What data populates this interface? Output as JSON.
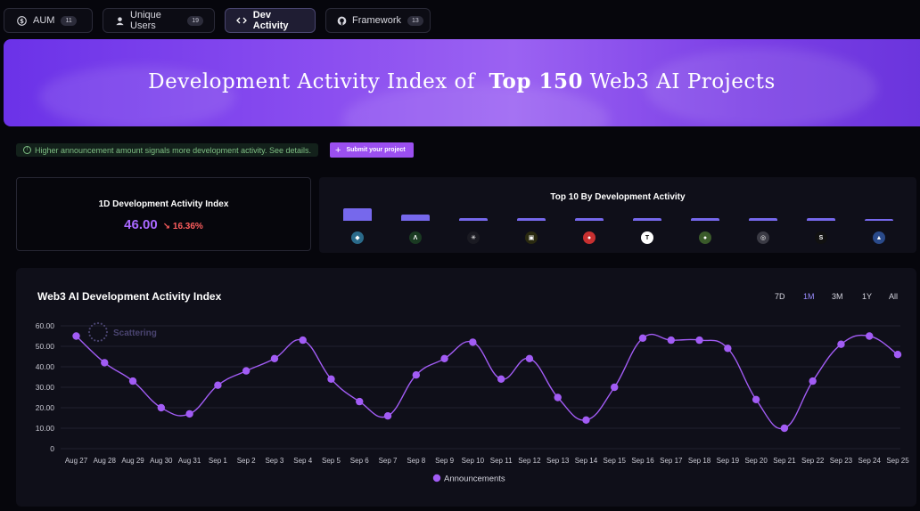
{
  "tabs": [
    {
      "label": "AUM",
      "badge": "11",
      "icon": "dollar-icon"
    },
    {
      "label": "Unique Users",
      "badge": "19",
      "icon": "user-icon"
    },
    {
      "label": "Dev Activity",
      "badge": "",
      "icon": "code-icon"
    },
    {
      "label": "Framework",
      "badge": "13",
      "icon": "github-icon"
    }
  ],
  "banner": {
    "prefix": "Development Activity Index of",
    "highlight": "Top 150",
    "suffix": "Web3 AI Projects"
  },
  "notice": {
    "text": "Higher announcement amount signals more development activity. See details."
  },
  "submit": {
    "label": "Submit your project"
  },
  "index_card": {
    "title": "1D Development Activity Index",
    "value": "46.00",
    "change": "16.36%",
    "change_arrow": "↘"
  },
  "top10": {
    "title": "Top 10 By Development Activity",
    "values": [
      100,
      48,
      24,
      24,
      22,
      22,
      22,
      22,
      22,
      10
    ],
    "icons": [
      {
        "name": "project-1-icon",
        "color": "#2a6a8a",
        "glyph": "◆"
      },
      {
        "name": "project-2-icon",
        "color": "#1a3a22",
        "glyph": "Λ"
      },
      {
        "name": "project-3-icon",
        "color": "#1a1a22",
        "glyph": "✳"
      },
      {
        "name": "project-4-icon",
        "color": "#2a2a10",
        "glyph": "▣"
      },
      {
        "name": "project-5-icon",
        "color": "#c83030",
        "glyph": "●"
      },
      {
        "name": "project-6-icon",
        "color": "#ffffff",
        "glyph": "T"
      },
      {
        "name": "project-7-icon",
        "color": "#3a5a2a",
        "glyph": "●"
      },
      {
        "name": "project-8-icon",
        "color": "#3a3a44",
        "glyph": "◎"
      },
      {
        "name": "project-9-icon",
        "color": "#111111",
        "glyph": "S"
      },
      {
        "name": "project-10-icon",
        "color": "#2a4a8a",
        "glyph": "▲"
      }
    ]
  },
  "main_chart": {
    "title": "Web3 AI Development Activity Index",
    "ranges": [
      "7D",
      "1M",
      "3M",
      "1Y",
      "All"
    ],
    "active_range": "1M",
    "watermark": "Scattering"
  },
  "chart_data": {
    "type": "line",
    "x": [
      "Aug 27",
      "Aug 28",
      "Aug 29",
      "Aug 30",
      "Aug 31",
      "Sep 1",
      "Sep 2",
      "Sep 3",
      "Sep 4",
      "Sep 5",
      "Sep 6",
      "Sep 7",
      "Sep 8",
      "Sep 9",
      "Sep 10",
      "Sep 11",
      "Sep 12",
      "Sep 13",
      "Sep 14",
      "Sep 15",
      "Sep 16",
      "Sep 17",
      "Sep 18",
      "Sep 19",
      "Sep 20",
      "Sep 21",
      "Sep 22",
      "Sep 23",
      "Sep 24",
      "Sep 25"
    ],
    "series": [
      {
        "name": "Announcements",
        "color": "#a25cf5",
        "values": [
          55,
          42,
          33,
          20,
          17,
          31,
          38,
          44,
          53,
          34,
          23,
          16,
          36,
          44,
          52,
          34,
          44,
          25,
          14,
          30,
          54,
          53,
          53,
          49,
          24,
          10,
          33,
          51,
          55,
          46
        ]
      }
    ],
    "ylim": [
      0,
      60
    ],
    "yticks": [
      "0",
      "10.00",
      "20.00",
      "30.00",
      "40.00",
      "50.00",
      "60.00"
    ],
    "legend": "bottom-center",
    "grid": true,
    "title": "Web3 AI Development Activity Index",
    "xlabel": "",
    "ylabel": ""
  },
  "colors": {
    "accent": "#9b4ff0",
    "line": "#a25cf5",
    "negative": "#ff5e5e",
    "notice": "#7fbf84"
  }
}
